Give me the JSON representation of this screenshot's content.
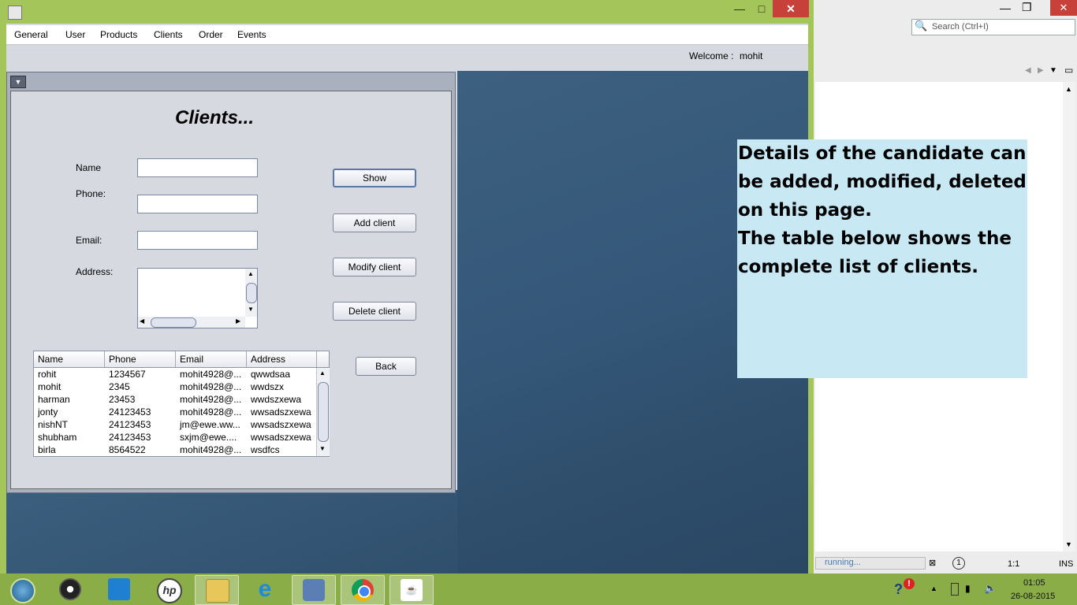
{
  "menu": [
    "General",
    "User",
    "Products",
    "Clients",
    "Order",
    "Events"
  ],
  "welcome": {
    "label": "Welcome :",
    "user": "mohit"
  },
  "window_controls": {
    "minimize": "—",
    "maximize": "□",
    "close": "✕"
  },
  "form": {
    "title": "Clients...",
    "labels": {
      "name": "Name",
      "phone": "Phone:",
      "email": "Email:",
      "address": "Address:"
    },
    "values": {
      "name": "",
      "phone": "",
      "email": "",
      "address": ""
    }
  },
  "buttons": {
    "show": "Show",
    "add": "Add client",
    "modify": "Modify client",
    "delete": "Delete client",
    "back": "Back"
  },
  "table": {
    "columns": [
      "Name",
      "Phone",
      "Email",
      "Address"
    ],
    "rows": [
      [
        "rohit",
        "1234567",
        "mohit4928@...",
        "qwwdsaa"
      ],
      [
        "mohit",
        "2345",
        "mohit4928@...",
        "wwdszx"
      ],
      [
        "harman",
        "23453",
        "mohit4928@...",
        "wwdszxewa"
      ],
      [
        "jonty",
        "24123453",
        "mohit4928@...",
        "wwsadszxewa"
      ],
      [
        "nishNT",
        "24123453",
        "jm@ewe.ww...",
        "wwsadszxewa"
      ],
      [
        "shubham",
        "24123453",
        "sxjm@ewe....",
        "wwsadszxewa"
      ],
      [
        "birla",
        "8564522",
        "mohit4928@...",
        "wsdfcs"
      ]
    ]
  },
  "note": {
    "line1": "Details of the candidate can be added, modified, deleted on this page.",
    "line2": "The table below shows the complete list of clients."
  },
  "ide": {
    "search_placeholder": "Search (Ctrl+I)",
    "status": "running...",
    "position": "1:1",
    "mode": "INS"
  },
  "clock": {
    "time": "01:05",
    "date": "26-08-2015"
  },
  "taskbar_icons": [
    "start-orb-icon",
    "camera-app-icon",
    "rocket-app-icon",
    "hp-icon",
    "file-explorer-icon",
    "internet-explorer-icon",
    "virtualbox-icon",
    "chrome-icon",
    "java-icon"
  ]
}
